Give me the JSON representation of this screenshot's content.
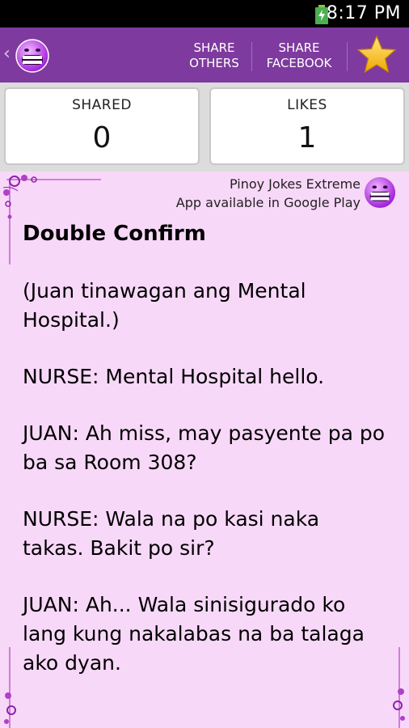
{
  "status_bar": {
    "time": "8:17 PM",
    "icon": "battery-charging-icon"
  },
  "action_bar": {
    "back_icon": "chevron-left-icon",
    "logo_icon": "grinning-face-icon",
    "share_others": [
      "SHARE",
      "OTHERS"
    ],
    "share_facebook": [
      "SHARE",
      "FACEBOOK"
    ],
    "favorite_icon": "star-icon"
  },
  "stats": {
    "shared_label": "SHARED",
    "shared_value": "0",
    "likes_label": "LIKES",
    "likes_value": "1"
  },
  "promo": {
    "line1": "Pinoy Jokes Extreme",
    "line2": "App available in Google Play"
  },
  "joke": {
    "title": "Double Confirm",
    "paragraphs": [
      "(Juan tinawagan ang Mental Hospital.)",
      "NURSE: Mental Hospital hello.",
      "JUAN: Ah miss, may pasyente pa po ba sa Room 308?",
      "NURSE: Wala na po kasi naka takas. Bakit po sir?",
      "JUAN: Ah... Wala sinisigurado ko lang kung nakalabas na ba talaga ako dyan."
    ]
  },
  "colors": {
    "action_bar": "#7e3a9e",
    "content_bg": "#f8d8f8",
    "star": "#f5c518"
  }
}
